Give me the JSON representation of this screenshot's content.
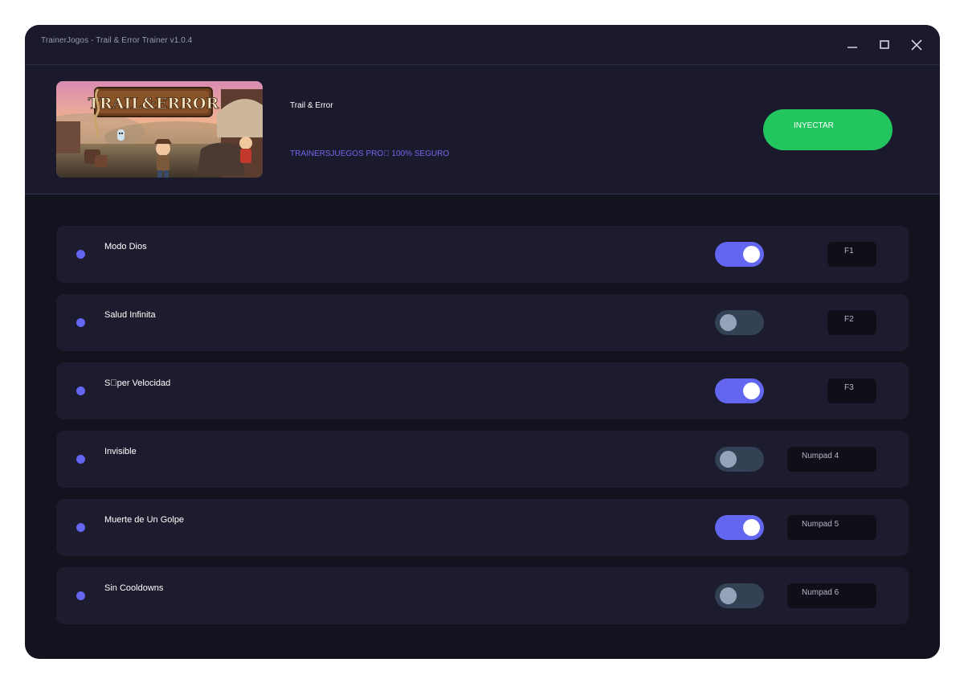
{
  "window": {
    "title": "TrainerJogos - Trail & Error Trainer v1.0.4",
    "controls": [
      "minimize-icon",
      "maximize-icon",
      "close-icon"
    ]
  },
  "header": {
    "game_name": "Trail & Error",
    "subtitle": "TRAINERSJUEGOS PRO\u0000 100% SEGURO",
    "inject_label": "INYECTAR",
    "logo_text": "TRAIL&ERROR"
  },
  "colors": {
    "accent": "#6366f1",
    "inject": "#22c55e",
    "toggle_off": "#334155",
    "background": "#13131f",
    "panel": "#1c1c2e"
  },
  "cheats": [
    {
      "label": "Modo Dios",
      "enabled": true,
      "hotkey": "F1"
    },
    {
      "label": "Salud Infinita",
      "enabled": false,
      "hotkey": "F2"
    },
    {
      "label": "S\u0000per Velocidad",
      "enabled": true,
      "hotkey": "F3"
    },
    {
      "label": "Invisible",
      "enabled": false,
      "hotkey": "Numpad 4"
    },
    {
      "label": "Muerte de Un Golpe",
      "enabled": true,
      "hotkey": "Numpad 5"
    },
    {
      "label": "Sin Cooldowns",
      "enabled": false,
      "hotkey": "Numpad 6"
    }
  ]
}
